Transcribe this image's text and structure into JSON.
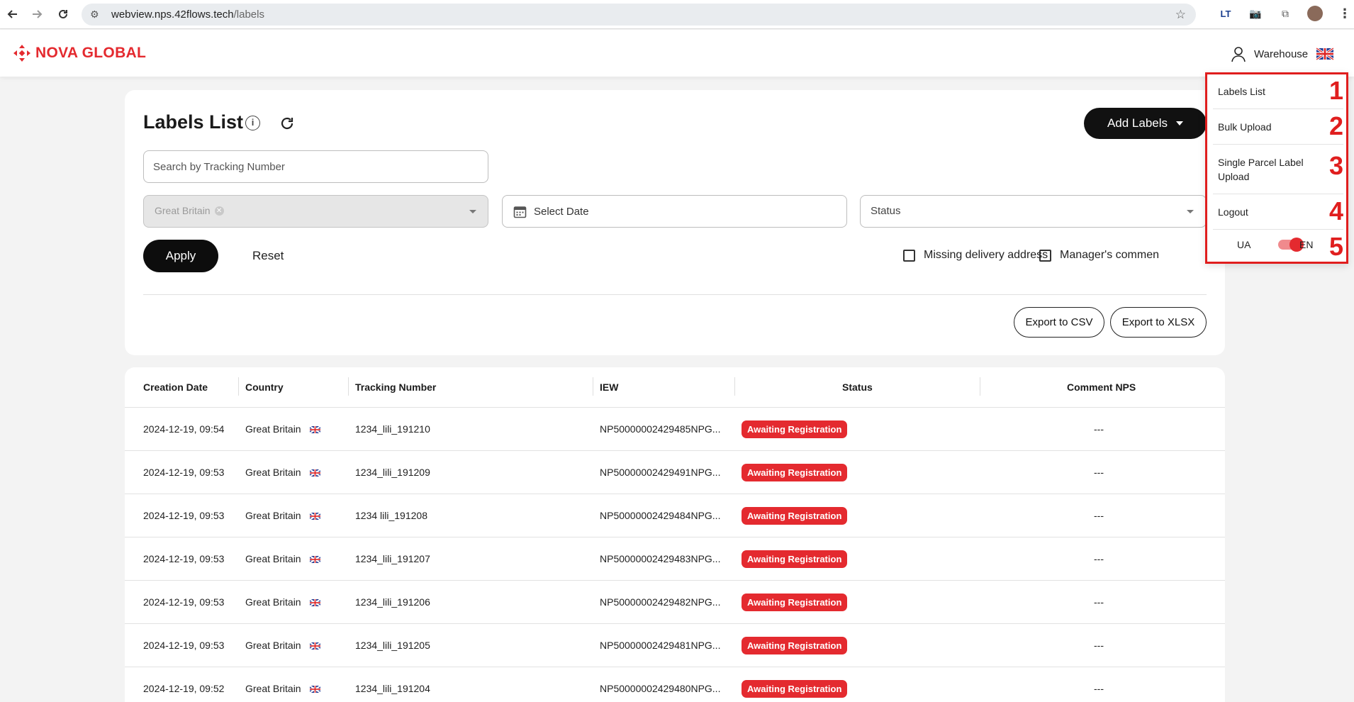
{
  "browser": {
    "url_host": "webview.nps.42flows.tech",
    "url_path": "/labels"
  },
  "header": {
    "logo_text": "NOVA GLOBAL",
    "user_label": "Warehouse"
  },
  "page": {
    "title": "Labels List",
    "add_button": "Add Labels"
  },
  "filters": {
    "search_placeholder": "Search by Tracking Number",
    "country_chip": "Great Britain",
    "date_placeholder": "Select Date",
    "status_placeholder": "Status",
    "apply": "Apply",
    "reset": "Reset",
    "missing_address": "Missing delivery address",
    "manager_comment": "Manager's commen"
  },
  "export": {
    "csv": "Export to CSV",
    "xlsx": "Export to XLSX"
  },
  "table": {
    "columns": [
      "Creation Date",
      "Country",
      "Tracking Number",
      "IEW",
      "Status",
      "Comment NPS"
    ],
    "rows": [
      {
        "date": "2024-12-19, 09:54",
        "country": "Great Britain",
        "tracking": "1234_lili_191210",
        "iew": "NP50000002429485NPG...",
        "status": "Awaiting Registration",
        "comment": "---"
      },
      {
        "date": "2024-12-19, 09:53",
        "country": "Great Britain",
        "tracking": "1234_lili_191209",
        "iew": "NP50000002429491NPG...",
        "status": "Awaiting Registration",
        "comment": "---"
      },
      {
        "date": "2024-12-19, 09:53",
        "country": "Great Britain",
        "tracking": "1234 lili_191208",
        "iew": "NP50000002429484NPG...",
        "status": "Awaiting Registration",
        "comment": "---"
      },
      {
        "date": "2024-12-19, 09:53",
        "country": "Great Britain",
        "tracking": "1234_lili_191207",
        "iew": "NP50000002429483NPG...",
        "status": "Awaiting Registration",
        "comment": "---"
      },
      {
        "date": "2024-12-19, 09:53",
        "country": "Great Britain",
        "tracking": "1234_lili_191206",
        "iew": "NP50000002429482NPG...",
        "status": "Awaiting Registration",
        "comment": "---"
      },
      {
        "date": "2024-12-19, 09:53",
        "country": "Great Britain",
        "tracking": "1234_lili_191205",
        "iew": "NP50000002429481NPG...",
        "status": "Awaiting Registration",
        "comment": "---"
      },
      {
        "date": "2024-12-19, 09:52",
        "country": "Great Britain",
        "tracking": "1234_lili_191204",
        "iew": "NP50000002429480NPG...",
        "status": "Awaiting Registration",
        "comment": "---"
      }
    ]
  },
  "menu": {
    "items": [
      {
        "label": "Labels List",
        "num": "1"
      },
      {
        "label": "Bulk Upload",
        "num": "2"
      },
      {
        "label": "Single Parcel Label Upload",
        "num": "3"
      },
      {
        "label": "Logout",
        "num": "4"
      }
    ],
    "lang_num": "5",
    "lang_left": "UA",
    "lang_right": "EN"
  },
  "colors": {
    "brand_red": "#e42a2f",
    "annotation_red": "#e01e1e"
  }
}
